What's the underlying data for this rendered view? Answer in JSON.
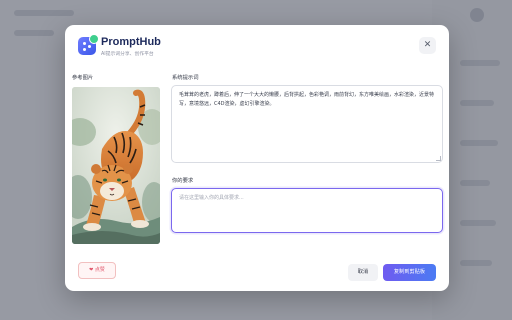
{
  "modal": {
    "app_title": "PromptHub",
    "app_subtitle": "AI提示词分享、创作平台",
    "close_glyph": "✕"
  },
  "reference": {
    "label": "参考图片",
    "image": "tiger-watercolor-illustration"
  },
  "system_prompt": {
    "label": "系统提示词",
    "value": "毛茸茸的老虎，蹲着后，伸了一个大大的懒腰，后背拱起，色彩艳调，雨前背幻，东方唯美绘画，水彩渲染，近景特写，意境悠远，C4D渲染，虚幻引擎渲染。"
  },
  "user_request": {
    "label": "你的要求",
    "placeholder": "请在这里输入你的具体要求..."
  },
  "footer": {
    "like_icon": "heart-icon",
    "like_label": "点赞",
    "cancel_label": "取消",
    "copy_label": "复制到剪贴板"
  },
  "colors": {
    "accent": "#6f5bf0",
    "accent2": "#4b7bf3",
    "like": "#e0556a",
    "title": "#1d2a5c"
  }
}
